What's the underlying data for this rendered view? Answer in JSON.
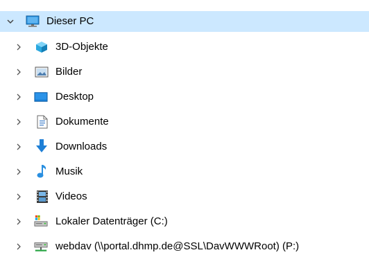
{
  "tree": {
    "root": {
      "label": "Dieser PC",
      "icon": "monitor-icon",
      "expanded": true,
      "selected": true
    },
    "items": [
      {
        "label": "3D-Objekte",
        "icon": "3d-cube-icon"
      },
      {
        "label": "Bilder",
        "icon": "pictures-folder-icon"
      },
      {
        "label": "Desktop",
        "icon": "desktop-folder-icon"
      },
      {
        "label": "Dokumente",
        "icon": "document-icon"
      },
      {
        "label": "Downloads",
        "icon": "download-arrow-icon"
      },
      {
        "label": "Musik",
        "icon": "music-note-icon"
      },
      {
        "label": "Videos",
        "icon": "film-strip-icon"
      },
      {
        "label": "Lokaler Datenträger (C:)",
        "icon": "drive-icon"
      },
      {
        "label": "webdav (\\\\portal.dhmp.de@SSL\\DavWWWRoot) (P:)",
        "icon": "network-drive-icon"
      }
    ]
  },
  "colors": {
    "selection": "#cce8ff",
    "chevron": "#555555",
    "accent": "#1e90d6"
  }
}
